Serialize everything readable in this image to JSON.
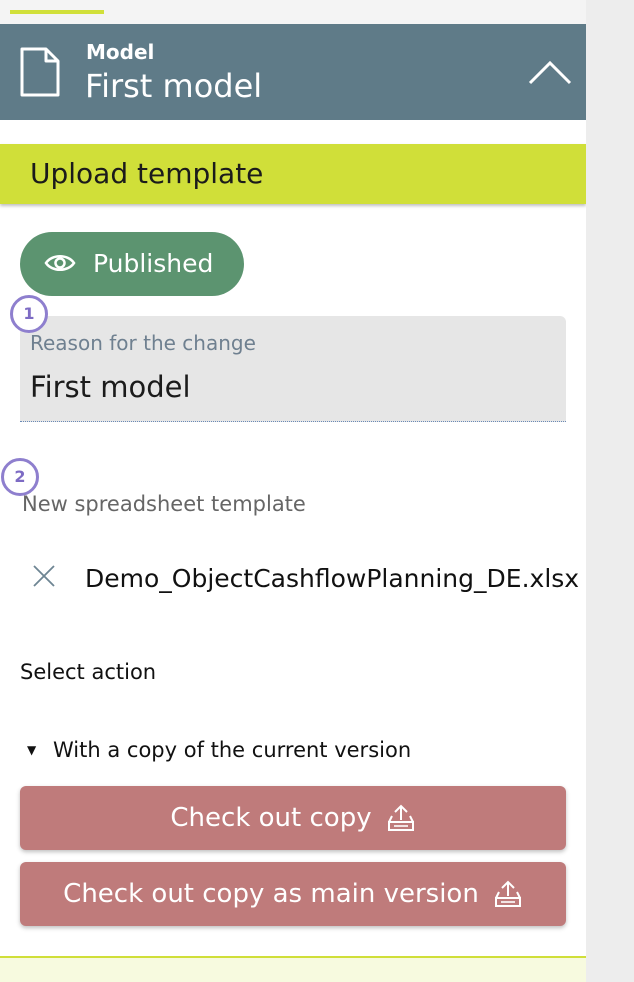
{
  "header": {
    "kicker": "Model",
    "title": "First model",
    "icon": "document-icon",
    "toggle_icon": "chevron-up-icon",
    "color": "#5f7b88"
  },
  "upload_section": {
    "title": "Upload template",
    "color": "#d0df39"
  },
  "status": {
    "label": "Published",
    "icon": "eye-icon",
    "color": "#5c9470"
  },
  "steps": [
    "1",
    "2"
  ],
  "reason_field": {
    "label": "Reason for the change",
    "value": "First model"
  },
  "spreadsheet": {
    "label": "New spreadsheet template",
    "file_name": "Demo_ObjectCashflowPlanning_DE.xlsx",
    "remove_icon": "close-icon"
  },
  "action": {
    "label": "Select action",
    "option": "With a copy of the current version",
    "buttons": [
      {
        "label": "Check out copy",
        "icon": "upload-tray-icon"
      },
      {
        "label": "Check out copy as main version",
        "icon": "upload-tray-icon"
      }
    ],
    "button_color": "#bf7b7b"
  }
}
